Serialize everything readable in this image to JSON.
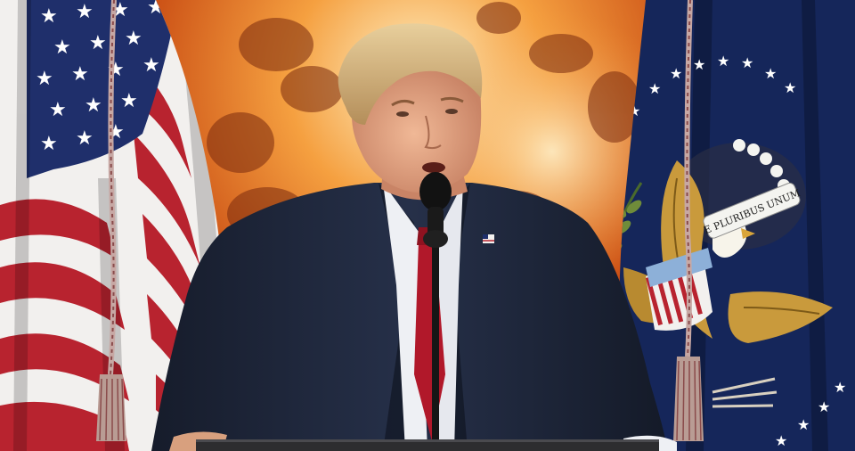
{
  "scene": {
    "description_visible_text": "",
    "colors": {
      "fire_core": "#fff2c8",
      "fire_mid": "#f5a040",
      "fire_outer": "#c84a12",
      "smoke_dark": "#3a1208",
      "flag_red": "#b8232f",
      "flag_white": "#f2f0ee",
      "flag_blue": "#1f2f6b",
      "presidential_blue": "#15265a",
      "suit": "#1e2638",
      "shirt": "#eef0f4",
      "tie": "#b1182a",
      "skin": "#e2a585",
      "hair": "#d8b981",
      "gold": "#c99a3c",
      "mic": "#121212"
    },
    "seal_banner_text": "E PLURIBUS UNUM"
  }
}
